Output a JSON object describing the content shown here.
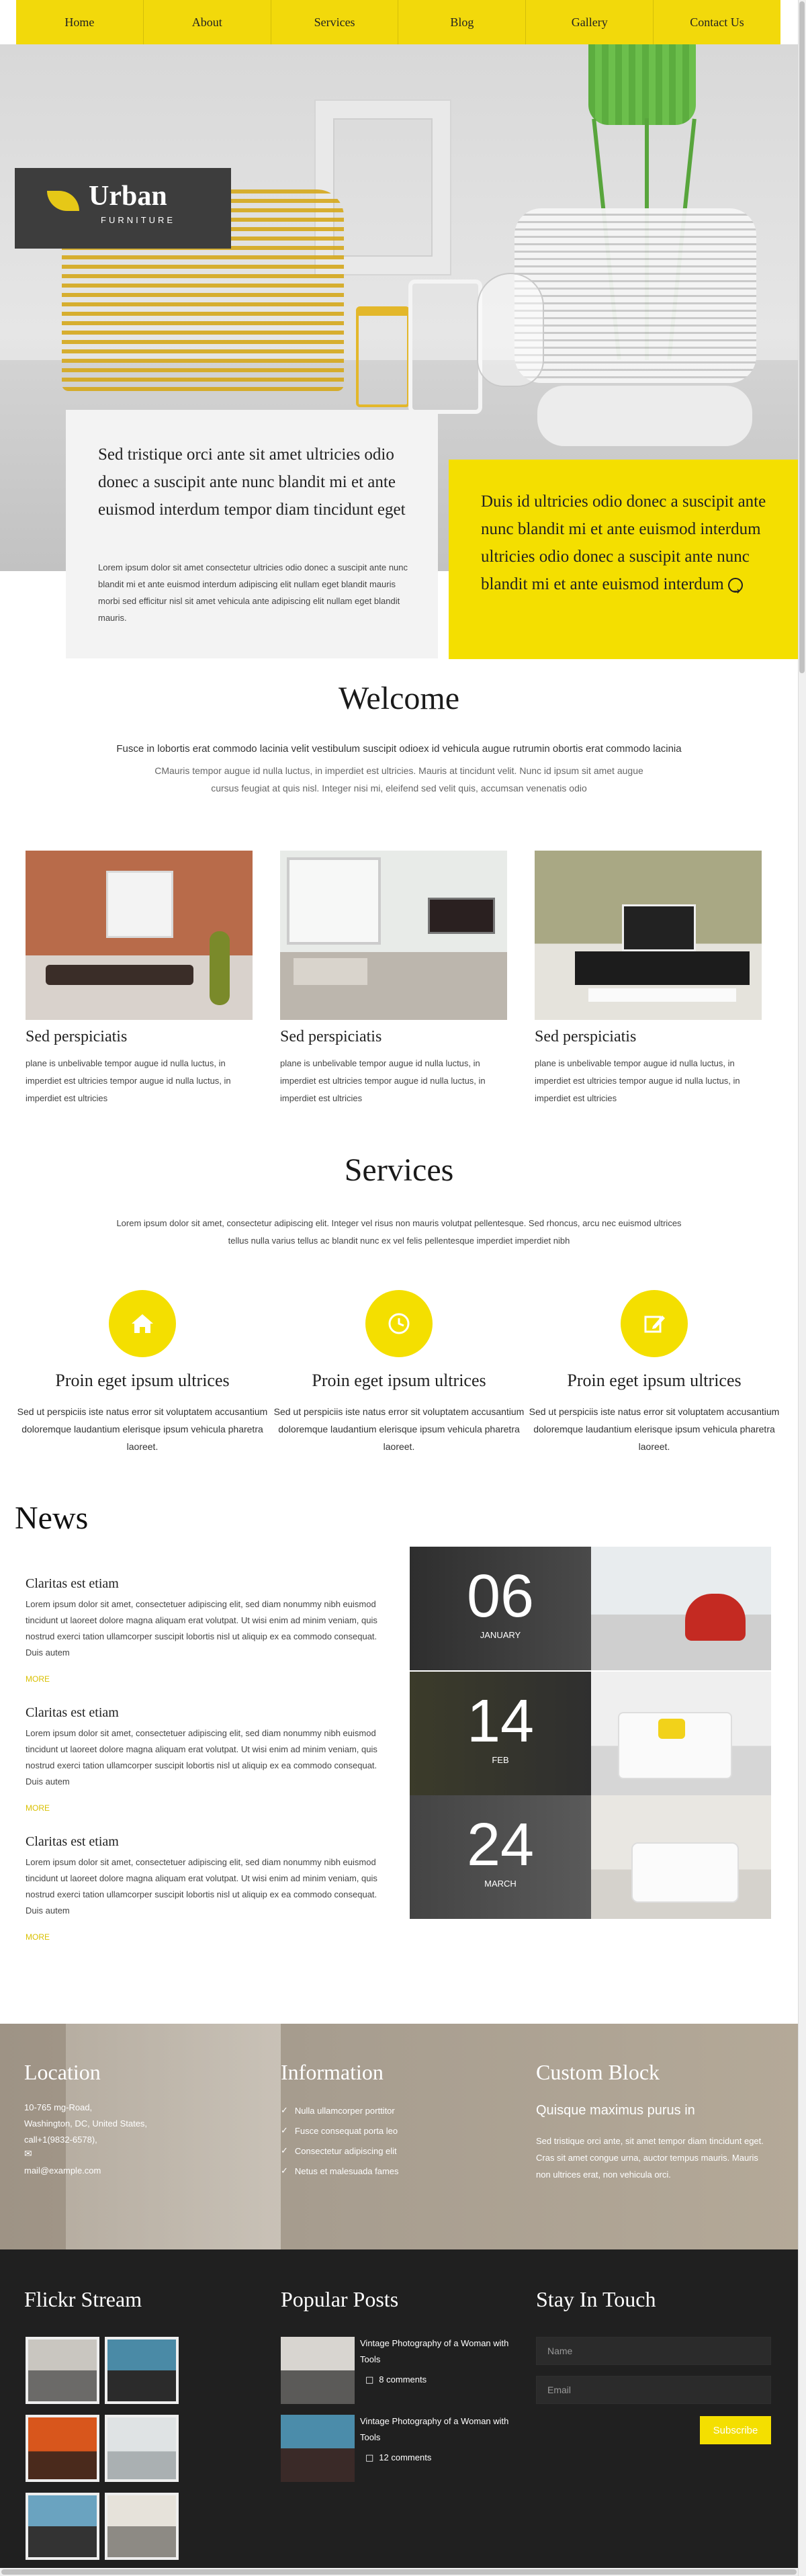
{
  "nav": [
    "Home",
    "About",
    "Services",
    "Blog",
    "Gallery",
    "Contact Us"
  ],
  "brand": {
    "name": "Urban",
    "sub": "FURNITURE"
  },
  "hero": {
    "white_title": "Sed tristique orci ante sit amet ultricies odio donec a suscipit ante nunc blandit mi et ante euismod interdum tempor diam tincidunt eget",
    "white_text": "Lorem ipsum dolor sit amet consectetur ultricies odio donec a suscipit ante nunc blandit mi et ante euismod interdum adipiscing elit nullam eget blandit mauris morbi sed efficitur nisl sit amet vehicula ante adipiscing elit nullam eget blandit mauris.",
    "yellow_text": "Duis id ultricies odio donec a suscipit ante nunc blandit mi et ante euismod interdum ultricies odio donec a suscipit ante nunc blandit mi et ante euismod interdum"
  },
  "welcome": {
    "title": "Welcome",
    "lead": "Fusce in lobortis erat commodo lacinia velit vestibulum suscipit odioex id vehicula augue rutrumin obortis erat commodo lacinia",
    "text": "CMauris tempor augue id nulla luctus, in imperdiet est ultricies. Mauris at tincidunt velit. Nunc id ipsum sit amet augue cursus feugiat at quis nisl. Integer nisi mi, eleifend sed velit quis, accumsan venenatis odio",
    "items": [
      {
        "title": "Sed perspiciatis",
        "text": "plane is unbelivable tempor augue id nulla luctus, in imperdiet est ultricies tempor augue id nulla luctus, in imperdiet est ultricies"
      },
      {
        "title": "Sed perspiciatis",
        "text": "plane is unbelivable tempor augue id nulla luctus, in imperdiet est ultricies tempor augue id nulla luctus, in imperdiet est ultricies"
      },
      {
        "title": "Sed perspiciatis",
        "text": "plane is unbelivable tempor augue id nulla luctus, in imperdiet est ultricies tempor augue id nulla luctus, in imperdiet est ultricies"
      }
    ]
  },
  "services": {
    "title": "Services",
    "lead": "Lorem ipsum dolor sit amet, consectetur adipiscing elit. Integer vel risus non mauris volutpat pellentesque. Sed rhoncus, arcu nec euismod ultrices tellus nulla varius tellus ac blandit nunc ex vel felis pellentesque imperdiet imperdiet nibh",
    "items": [
      {
        "icon": "home-icon",
        "title": "Proin eget ipsum ultrices",
        "text": "Sed ut perspiciis iste natus error sit voluptatem accusantium doloremque laudantium elerisque ipsum vehicula pharetra laoreet."
      },
      {
        "icon": "clock-icon",
        "title": "Proin eget ipsum ultrices",
        "text": "Sed ut perspiciis iste natus error sit voluptatem accusantium doloremque laudantium elerisque ipsum vehicula pharetra laoreet."
      },
      {
        "icon": "edit-icon",
        "title": "Proin eget ipsum ultrices",
        "text": "Sed ut perspiciis iste natus error sit voluptatem accusantium doloremque laudantium elerisque ipsum vehicula pharetra laoreet."
      }
    ]
  },
  "news": {
    "title": "News",
    "items": [
      {
        "title": "Claritas est etiam",
        "text": "Lorem ipsum dolor sit amet, consectetuer adipiscing elit, sed diam nonummy nibh euismod tincidunt ut laoreet dolore magna aliquam erat volutpat. Ut wisi enim ad minim veniam, quis nostrud exerci tation ullamcorper suscipit lobortis nisl ut aliquip ex ea commodo consequat. Duis autem",
        "more": "MORE"
      },
      {
        "title": "Claritas est etiam",
        "text": "Lorem ipsum dolor sit amet, consectetuer adipiscing elit, sed diam nonummy nibh euismod tincidunt ut laoreet dolore magna aliquam erat volutpat. Ut wisi enim ad minim veniam, quis nostrud exerci tation ullamcorper suscipit lobortis nisl ut aliquip ex ea commodo consequat. Duis autem",
        "more": "MORE"
      },
      {
        "title": "Claritas est etiam",
        "text": "Lorem ipsum dolor sit amet, consectetuer adipiscing elit, sed diam nonummy nibh euismod tincidunt ut laoreet dolore magna aliquam erat volutpat. Ut wisi enim ad minim veniam, quis nostrud exerci tation ullamcorper suscipit lobortis nisl ut aliquip ex ea commodo consequat. Duis autem",
        "more": "MORE"
      }
    ],
    "dates": [
      {
        "day": "06",
        "month": "JANUARY"
      },
      {
        "day": "14",
        "month": "FEB"
      },
      {
        "day": "24",
        "month": "MARCH"
      }
    ]
  },
  "footer_top": {
    "location": {
      "title": "Location",
      "lines": [
        "10-765 mg-Road,",
        "Washington, DC, United States,",
        "call+1(9832-6578),"
      ],
      "email": "mail@example.com"
    },
    "information": {
      "title": "Information",
      "items": [
        "Nulla ullamcorper porttitor",
        "Fusce consequat porta leo",
        "Consectetur adipiscing elit",
        "Netus et malesuada fames"
      ]
    },
    "custom": {
      "title": "Custom Block",
      "subtitle": "Quisque maximus purus in",
      "text": "Sed tristique orci ante, sit amet tempor diam tincidunt eget. Cras sit amet congue urna, auctor tempus mauris. Mauris non ultrices erat, non vehicula orci."
    }
  },
  "footer_bottom": {
    "flickr_title": "Flickr Stream",
    "posts_title": "Popular Posts",
    "posts": [
      {
        "title": "Vintage Photography of a Woman with Tools",
        "comments": "8 comments"
      },
      {
        "title": "Vintage Photography of a Woman with Tools",
        "comments": "12 comments"
      }
    ],
    "stay_title": "Stay In Touch",
    "name_placeholder": "Name",
    "email_placeholder": "Email",
    "subscribe": "Subscribe"
  },
  "colors": {
    "accent": "#f4df00",
    "dark": "#202020"
  }
}
